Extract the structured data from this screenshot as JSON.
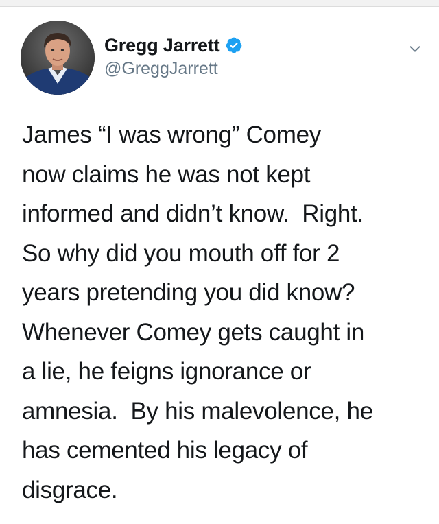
{
  "author": {
    "display_name": "Gregg Jarrett",
    "handle": "@GreggJarrett",
    "verified": true,
    "verified_color": "#1da1f2"
  },
  "tweet": {
    "text": "James “I was wrong” Comey\nnow claims he was not kept\ninformed and didn’t know.  Right.\nSo why did you mouth off for 2\nyears pretending you did know?\nWhenever Comey gets caught in\na lie, he feigns ignorance or\namnesia.  By his malevolence, he\nhas cemented his legacy of\ndisgrace."
  },
  "icons": {
    "verified": "verified-badge-icon",
    "menu": "chevron-down-icon",
    "avatar": "avatar"
  }
}
